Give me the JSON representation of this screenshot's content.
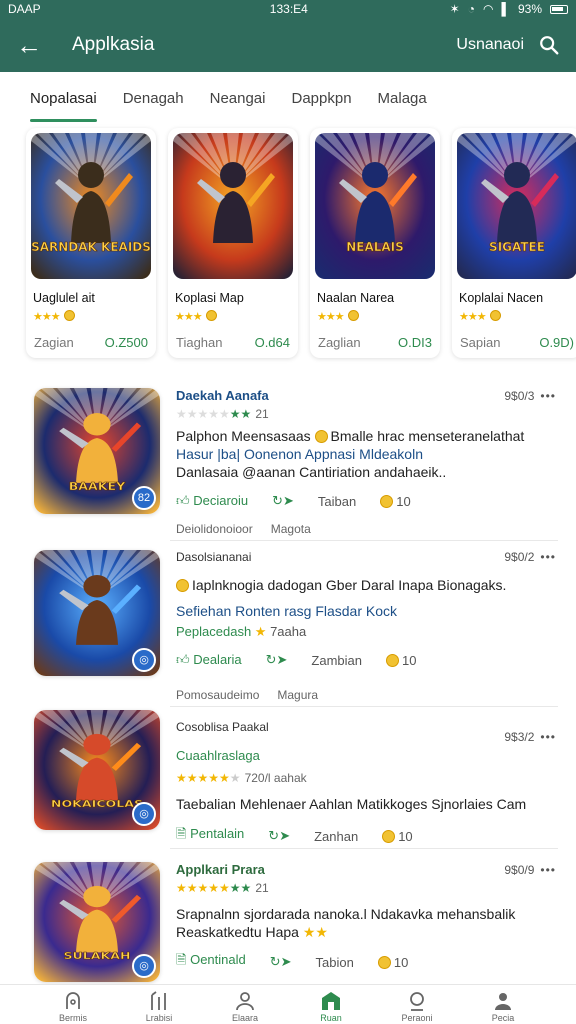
{
  "status_bar": {
    "left": "DAAP",
    "time": "133:E4",
    "battery": "93%"
  },
  "app_bar": {
    "title": "Applkasia",
    "action_label": "Usnanaoi"
  },
  "tabs": [
    {
      "label": "Nopalasai",
      "active": true
    },
    {
      "label": "Denagah",
      "active": false
    },
    {
      "label": "Neangai",
      "active": false
    },
    {
      "label": "Dappkpn",
      "active": false
    },
    {
      "label": "Malaga",
      "active": false
    }
  ],
  "featured": [
    {
      "art_text": "SARNDAK KEAIDS",
      "name": "Uaglulel ait",
      "label": "Zagian",
      "price": "O.Z500",
      "palette": [
        "#2a4f9e",
        "#f08a1e",
        "#3b2d1c"
      ]
    },
    {
      "art_text": "",
      "name": "Koplasi Map",
      "label": "Tiaghan",
      "price": "O.d64",
      "palette": [
        "#c63a1c",
        "#f5a623",
        "#2a2233"
      ]
    },
    {
      "art_text": "NEALAIS",
      "name": "Naalan Narea",
      "label": "Zaglian",
      "price": "O.DI3",
      "palette": [
        "#2e1a6b",
        "#ff7a2a",
        "#1b2a6e"
      ]
    },
    {
      "art_text": "SIGATEE",
      "name": "Koplalai Nacen",
      "label": "Sapian",
      "price": "O.9D)",
      "palette": [
        "#1f3fa8",
        "#d82b5a",
        "#222a55"
      ]
    }
  ],
  "list": [
    {
      "name": "Daekah Aanafa",
      "rating_num": "21",
      "date": "9$0/3",
      "desc": "Palphon Meensasaas",
      "desc_tail": "Bmalle hrac menseteranelathat",
      "desc2": "Hasur |ba| Oonenon Appnasi Mldeakoln",
      "desc3": "Danlasaia @aanan Cantiriation andahaeik..",
      "act1": "Deciaroiu",
      "act2": "Taiban",
      "act3": "10",
      "meta1": "Deiolidonoioor",
      "meta2": "Magota",
      "thumb_text": "BAAKEY",
      "badge": "82",
      "palette": [
        "#1c2b6e",
        "#e8452a",
        "#f2b13b"
      ]
    },
    {
      "name": "Dasolsiananai",
      "date": "9$0/2",
      "desc": "Iaplnknogia dadogan Gber Daral Inapa Bionagaks.",
      "desc2": "Sefiehan Ronten rasg Flasdar Kock",
      "sub": "Peplacedash",
      "sub_rating": "7aaha",
      "act1": "Dealaria",
      "act2": "Zambian",
      "act3": "10",
      "meta1": "Pomosaudeimo",
      "meta2": "Magura",
      "thumb_text": "",
      "badge": "",
      "palette": [
        "#1a4aa8",
        "#5bb0ff",
        "#6a3a1c"
      ]
    },
    {
      "name": "Cosoblisa Paakal",
      "date": "9$3/2",
      "desc": "Cuaahlraslaga",
      "rating_num": "720/l aahak",
      "desc2": "Taebalian Mehlenaer Aahlan Matikkoges Sjnorlaies Cam",
      "act1": "Pentalain",
      "act2": "Zanhan",
      "act3": "10",
      "thumb_text": "NOKAICOLAS",
      "badge": "",
      "palette": [
        "#241e55",
        "#ff8c1a",
        "#d64a2a"
      ]
    },
    {
      "name": "Applkari Prara",
      "rating_num": "21",
      "date": "9$0/9",
      "desc": "Srapnalnn sjordarada nanoka.l Ndakavka mehansbalik",
      "desc2": "Reaskatkedtu Hapa",
      "act1": "Oentinald",
      "act2": "Tabion",
      "act3": "10",
      "thumb_text": "SULAKAH",
      "badge": "",
      "palette": [
        "#3a2a8f",
        "#f05a2a",
        "#f2b13b"
      ]
    }
  ],
  "bottom_nav": [
    {
      "label": "Bermis",
      "icon": "gamepad-icon",
      "active": false
    },
    {
      "label": "Lrabisi",
      "icon": "tools-icon",
      "active": false
    },
    {
      "label": "Elaara",
      "icon": "person-icon",
      "active": false
    },
    {
      "label": "Ruan",
      "icon": "store-icon",
      "active": true
    },
    {
      "label": "Peraoni",
      "icon": "chat-icon",
      "active": false
    },
    {
      "label": "Pecia",
      "icon": "profile-icon",
      "active": false
    }
  ],
  "colors": {
    "primary": "#2f6b5c",
    "accent": "#2e8b4e",
    "star": "#f2b705",
    "link": "#1d4f87"
  }
}
